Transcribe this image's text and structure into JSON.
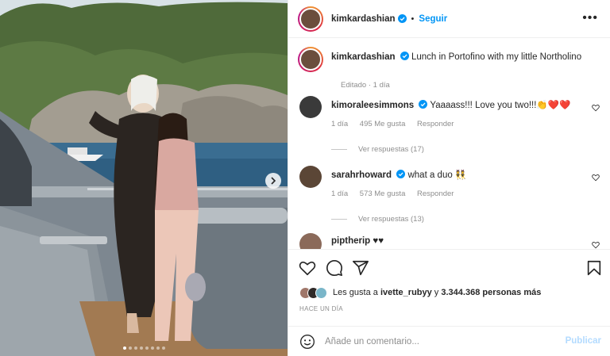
{
  "header": {
    "username": "kimkardashian",
    "follow_label": "Seguir",
    "more_label": "•••"
  },
  "caption": {
    "username": "kimkardashian",
    "text": "Lunch in Portofino with my little Northolino",
    "meta": "Editado · 1 día"
  },
  "comments": [
    {
      "username": "kimoraleesimmons",
      "text": "Yaaaass!!! Love you two!!!👏❤️❤️",
      "age": "1 día",
      "likes": "495 Me gusta",
      "reply_label": "Responder",
      "view_replies": "Ver respuestas (17)"
    },
    {
      "username": "sarahrhoward",
      "text": "what a duo 👯",
      "age": "1 día",
      "likes": "573 Me gusta",
      "reply_label": "Responder",
      "view_replies": "Ver respuestas (13)"
    },
    {
      "username": "piptherip",
      "text": "♥♥"
    }
  ],
  "likes": {
    "prefix": "Les gusta a ",
    "user": "ivette_rubyy",
    "middle": " y ",
    "count": "3.344.368 personas más"
  },
  "time_ago": "Hace un día",
  "add_comment": {
    "placeholder": "Añade un comentario...",
    "publish_label": "Publicar"
  },
  "carousel": {
    "total_slides": 8,
    "current_slide": 1
  },
  "colors": {
    "accent": "#0095f6",
    "publish_disabled": "#b3dbff",
    "muted": "#8e8e8e"
  }
}
